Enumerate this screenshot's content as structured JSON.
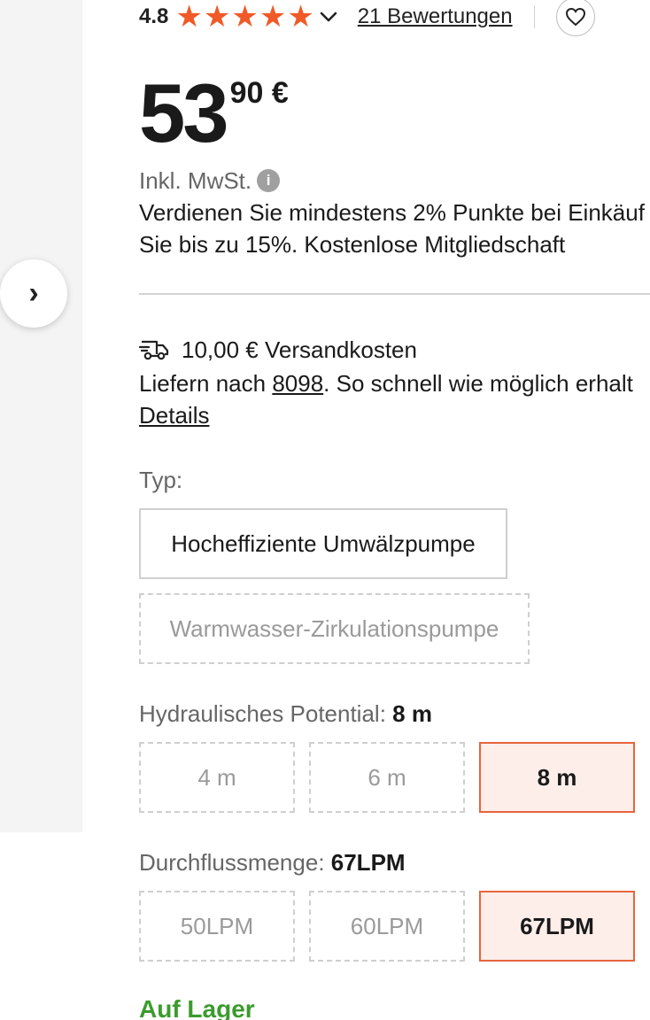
{
  "gallery": {
    "next_glyph": "›"
  },
  "rating": {
    "value": "4.8",
    "stars": [
      "★",
      "★",
      "★",
      "★",
      "★"
    ],
    "reviews_label": "21 Bewertungen",
    "star_color": "#f05a28"
  },
  "price": {
    "integer": "53",
    "decimal": "90 €"
  },
  "vat": {
    "label": "Inkl. MwSt.",
    "info_glyph": "i"
  },
  "points_lines": [
    "Verdienen Sie mindestens 2% Punkte bei Einkäuf",
    "Sie bis zu 15%. Kostenlose Mitgliedschaft"
  ],
  "shipping": {
    "cost_label": "10,00 € Versandkosten"
  },
  "delivery": {
    "prefix": "Liefern nach ",
    "zip": "8098",
    "suffix": ".  So schnell wie möglich erhalt",
    "details_label": "Details"
  },
  "typ": {
    "label": "Typ:",
    "options": [
      "Hocheffiziente Umwälzpumpe",
      "Warmwasser-Zirkulationspumpe"
    ]
  },
  "hydraulic": {
    "label": "Hydraulisches Potential: ",
    "selected": "8 m",
    "options": [
      "4 m",
      "6 m",
      "8 m"
    ]
  },
  "flow": {
    "label": "Durchflussmenge: ",
    "selected": "67LPM",
    "options": [
      "50LPM",
      "60LPM",
      "67LPM"
    ]
  },
  "stock": {
    "label": "Auf Lager"
  },
  "colors": {
    "accent": "#e8643c",
    "accent_bg": "#fdeeea",
    "in_stock": "#3b9b2d"
  }
}
